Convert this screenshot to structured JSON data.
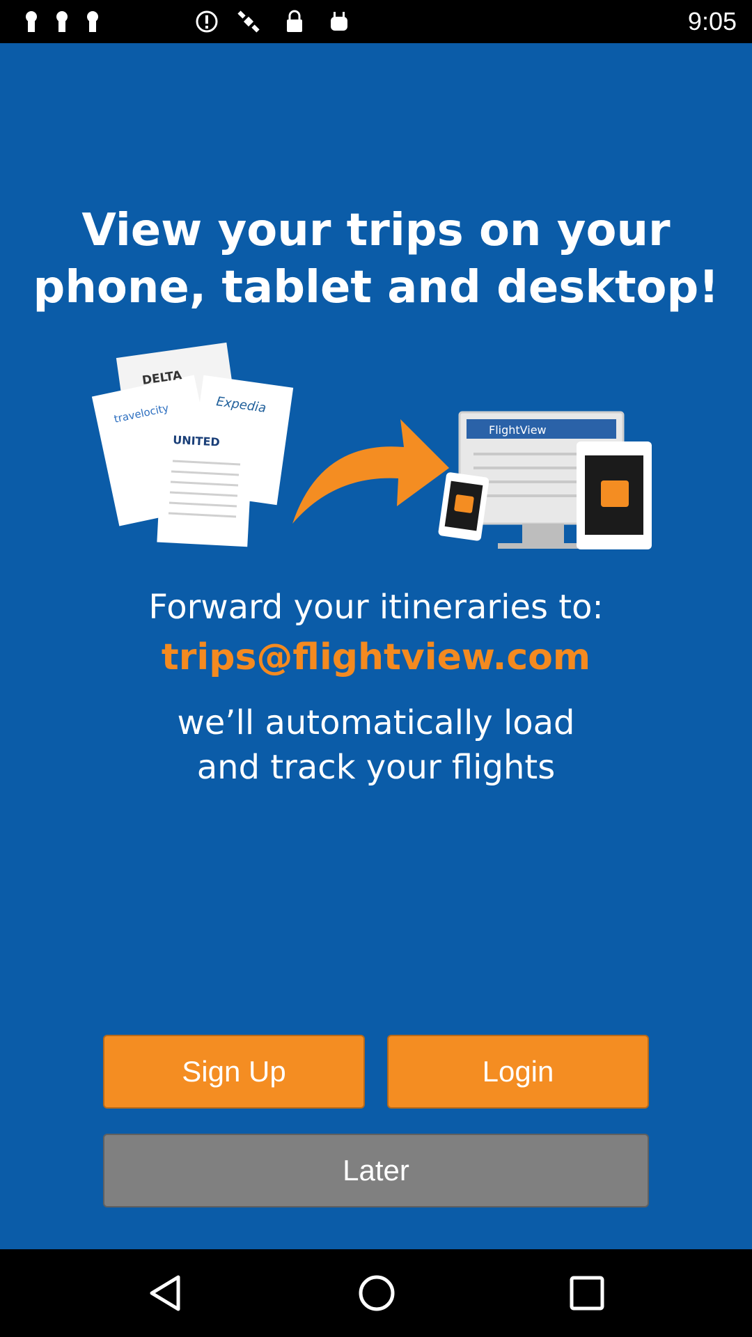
{
  "status_bar": {
    "time": "9:05",
    "icons": [
      "keyhole-icon",
      "keyhole-icon",
      "keyhole-icon",
      "info-icon",
      "satellite-icon",
      "lock-icon",
      "android-icon"
    ]
  },
  "main": {
    "headline_line1": "View your trips on your",
    "headline_line2": "phone, tablet and desktop!",
    "illustration": {
      "airline_labels": [
        "DELTA",
        "Expedia",
        "travelocity",
        "UNITED"
      ],
      "app_label": "FlightView"
    },
    "forward_text": "Forward your itineraries to:",
    "email": "trips@flightview.com",
    "auto_line1": "we’ll automatically load",
    "auto_line2": "and track your flights"
  },
  "buttons": {
    "signup": "Sign Up",
    "login": "Login",
    "later": "Later"
  },
  "colors": {
    "background": "#0b5ca8",
    "accent_orange": "#f48d22",
    "later_gray": "#808080"
  },
  "nav_bar": {
    "icons": [
      "back-icon",
      "home-icon",
      "recents-icon"
    ]
  }
}
